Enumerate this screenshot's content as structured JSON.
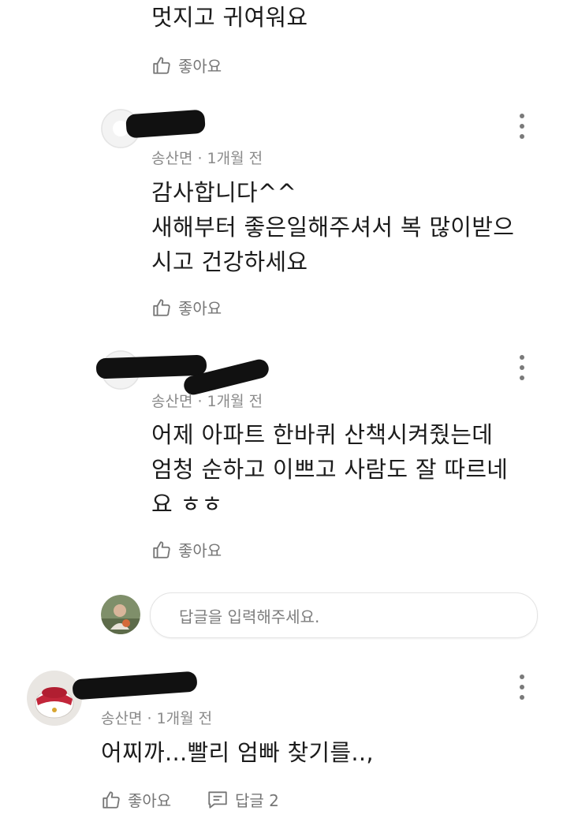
{
  "comments": [
    {
      "meta": "",
      "text_lines": [
        "멋지고 귀여워요"
      ],
      "like_label": "좋아요"
    },
    {
      "meta": "송산면 · 1개월 전",
      "text_lines": [
        "감사합니다^^",
        "새해부터 좋은일해주셔서 복 많이받으",
        "시고 건강하세요"
      ],
      "like_label": "좋아요"
    },
    {
      "meta": "송산면 · 1개월 전",
      "text_lines": [
        "어제 아파트 한바퀴 산책시켜줬는데",
        "엄청 순하고 이쁘고 사람도 잘 따르네",
        "요 ㅎㅎ"
      ],
      "like_label": "좋아요"
    },
    {
      "meta": "송산면 · 1개월 전",
      "text_lines": [
        "어찌까...빨리 엄빠 찾기를..,"
      ],
      "like_label": "좋아요",
      "reply_label": "답글 2"
    }
  ],
  "reply_input": {
    "placeholder": "답글을 입력해주세요."
  },
  "colors": {
    "text": "#1c1c1c",
    "meta": "#8a8a8a",
    "icon": "#767676",
    "redaction": "#111111"
  }
}
